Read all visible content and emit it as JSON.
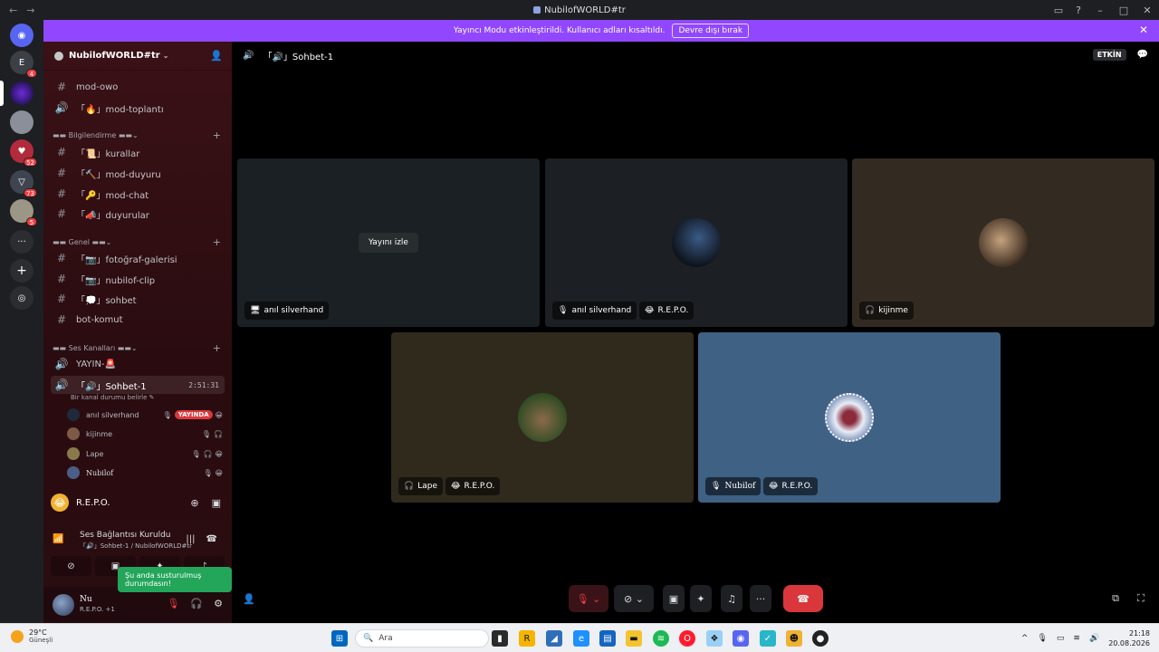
{
  "window": {
    "title": "NubilofWORLD#tr",
    "back_glyph": "←",
    "fwd_glyph": "→"
  },
  "banner": {
    "text": "Yayıncı Modu etkinleştirildi. Kullanıcı adları kısaltıldı.",
    "button_label": "Devre dışı bırak"
  },
  "rail": {
    "badges": [
      "4",
      "52",
      "73",
      "5"
    ],
    "more_label": "···"
  },
  "guild": {
    "name": "NubilofWORLD#tr"
  },
  "channels": {
    "mod_owo": "mod-owo",
    "mod_toplanti": "「🔥」mod-toplantı",
    "cat_bilgilendirme": "▬▬ Bilgilendirme ▬▬",
    "kurallar": "「📜」kurallar",
    "mod_duyuru": "「🔨」mod-duyuru",
    "mod_chat": "「🔑」mod-chat",
    "duyurular": "「📣」duyurular",
    "cat_genel": "▬▬ Genel ▬▬",
    "fotograf": "「📷」fotoğraf-galerisi",
    "clip": "「📷」nubilof-clip",
    "sohbet": "「💭」sohbet",
    "bot_komut": "bot-komut",
    "cat_ses": "▬▬ Ses Kanalları ▬▬",
    "yayin": "YAYIN-🚨",
    "sohbet1": "「🔊」Sohbet-1",
    "sohbet1_time": "2:51:31",
    "status_hint": "Bir kanal durumu belirle ✎"
  },
  "voice_users": [
    {
      "name": "anıl silverhand",
      "badge": "YAYINDA",
      "color": "#1e2a3a"
    },
    {
      "name": "kijinme",
      "badge": "",
      "color": "#7c5a45"
    },
    {
      "name": "Lape",
      "badge": "",
      "color": "#8a7a4a"
    },
    {
      "name": "Nubilof",
      "badge": "",
      "color": "#4a5e86"
    }
  ],
  "activity": {
    "name": "R.E.P.O."
  },
  "voice_panel": {
    "status": "Ses Bağlantısı Kuruldu",
    "channel": "「🔊」Sohbet-1 / NubilofWORLD#tr"
  },
  "toast": "Şu anda susturulmuş durumdasın!",
  "user": {
    "name": "Nu",
    "status": "R.E.P.O. +1"
  },
  "topbar": {
    "channel": "「🔊」Sohbet-1",
    "active_label": "ETKİN"
  },
  "tiles": [
    {
      "label": "anıl silverhand",
      "extra": "",
      "watch": "Yayını izle",
      "bg": "#1b2024"
    },
    {
      "label": "anıl silverhand",
      "extra": "R.E.P.O.",
      "bg": "#1c1f23",
      "avatar": "#22324a"
    },
    {
      "label": "kijinme",
      "extra": "",
      "bg": "#332b22",
      "avatar": "#7c5a45"
    },
    {
      "label": "Lape",
      "extra": "R.E.P.O.",
      "bg": "#2f2a1c",
      "avatar": "#6b6c3a"
    },
    {
      "label": "Nubilof",
      "extra": "R.E.P.O.",
      "bg": "#3e6184",
      "avatar": "#c8d2e6"
    }
  ],
  "taskbar": {
    "temp": "29°C",
    "weather": "Güneşli",
    "search_placeholder": "Ara",
    "time": "21:18",
    "date": "20.08.2026"
  },
  "colors": {
    "accent": "#9147ff",
    "danger": "#da373c",
    "online": "#23a55a"
  }
}
